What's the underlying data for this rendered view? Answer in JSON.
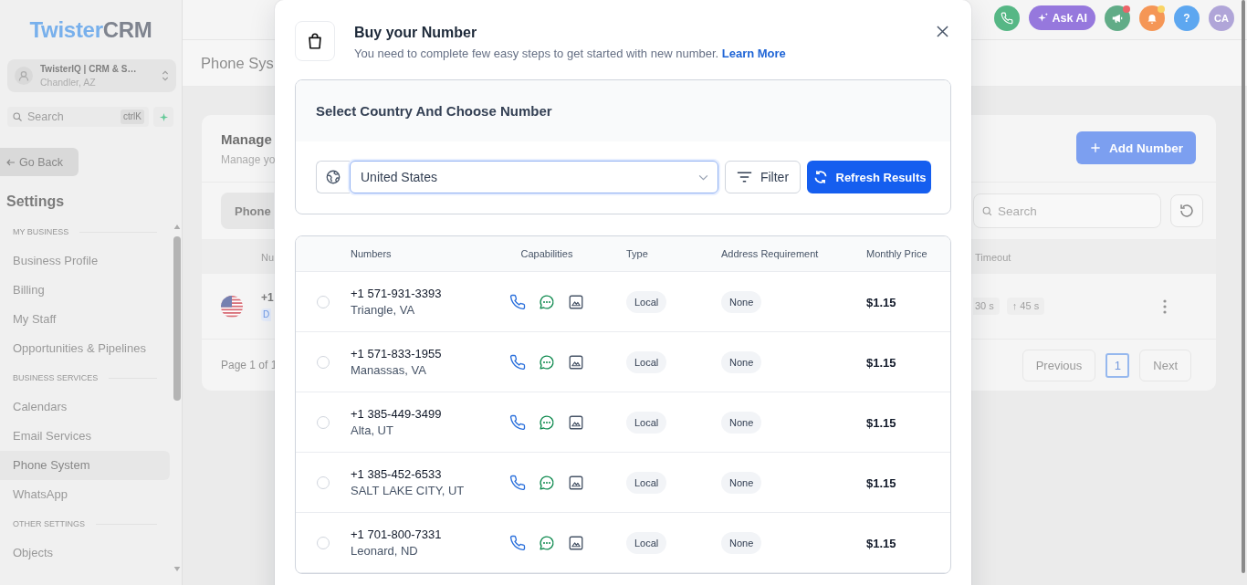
{
  "sidebar": {
    "brand": {
      "accent": "Twister",
      "rest": "CRM"
    },
    "account": {
      "name": "TwisterIQ | CRM & S…",
      "location": "Chandler, AZ"
    },
    "search": {
      "placeholder": "Search",
      "shortcut": "ctrlK"
    },
    "back_button": "Go Back",
    "heading": "Settings",
    "sections": [
      {
        "title": "MY BUSINESS",
        "items": [
          {
            "label": "Business Profile",
            "selected": false
          },
          {
            "label": "Billing",
            "selected": false
          },
          {
            "label": "My Staff",
            "selected": false
          },
          {
            "label": "Opportunities & Pipelines",
            "selected": false
          }
        ]
      },
      {
        "title": "BUSINESS SERVICES",
        "items": [
          {
            "label": "Calendars",
            "selected": false
          },
          {
            "label": "Email Services",
            "selected": false
          },
          {
            "label": "Phone System",
            "selected": true
          },
          {
            "label": "WhatsApp",
            "selected": false
          }
        ]
      },
      {
        "title": "OTHER SETTINGS",
        "items": [
          {
            "label": "Objects",
            "selected": false
          }
        ]
      }
    ]
  },
  "topbar": {
    "ask_ai": "Ask AI",
    "announcements_unread": true,
    "notifications_unread": true,
    "help": "?",
    "avatar": "CA"
  },
  "page": {
    "title": "Phone Sys",
    "card": {
      "title": "Manage",
      "subtitle": "Manage yo",
      "add_button": "Add Number",
      "tabs": [
        {
          "label": "Phone",
          "selected": true
        }
      ],
      "search": {
        "placeholder": "Search"
      },
      "columns": [
        "Nu",
        "Timeout"
      ],
      "rows": [
        {
          "number": "+1",
          "badge": "D",
          "timeouts": [
            "30 s",
            "↑ 45 s"
          ]
        }
      ],
      "pagination": {
        "summary": "Page 1 of 1",
        "previous": {
          "label": "Previous",
          "disabled": true
        },
        "pages": [
          {
            "label": "1",
            "selected": true
          }
        ],
        "next": {
          "label": "Next",
          "disabled": true
        }
      }
    }
  },
  "modal": {
    "title": "Buy your Number",
    "subtitle": "You need to complete few easy steps to get started with new number.",
    "link": "Learn More",
    "section": {
      "title": "Select Country And Choose Number",
      "country": "United States",
      "focused": true,
      "filter_button": "Filter",
      "refresh_button": "Refresh Results"
    },
    "table": {
      "columns": [
        "Numbers",
        "Capabilities",
        "Type",
        "Address Requirement",
        "Monthly Price"
      ],
      "rows": [
        {
          "number": "+1 571-931-3393",
          "location": "Triangle, VA",
          "selected": false,
          "capabilities": {
            "voice": true,
            "sms": true,
            "mms": true
          },
          "type": "Local",
          "address": "None",
          "price": "$1.15"
        },
        {
          "number": "+1 571-833-1955",
          "location": "Manassas, VA",
          "selected": false,
          "capabilities": {
            "voice": true,
            "sms": true,
            "mms": true
          },
          "type": "Local",
          "address": "None",
          "price": "$1.15"
        },
        {
          "number": "+1 385-449-3499",
          "location": "Alta, UT",
          "selected": false,
          "capabilities": {
            "voice": true,
            "sms": true,
            "mms": true
          },
          "type": "Local",
          "address": "None",
          "price": "$1.15"
        },
        {
          "number": "+1 385-452-6533",
          "location": "SALT LAKE CITY, UT",
          "selected": false,
          "capabilities": {
            "voice": true,
            "sms": true,
            "mms": true
          },
          "type": "Local",
          "address": "None",
          "price": "$1.15"
        },
        {
          "number": "+1 701-800-7331",
          "location": "Leonard, ND",
          "selected": false,
          "capabilities": {
            "voice": true,
            "sms": true,
            "mms": true
          },
          "type": "Local",
          "address": "None",
          "price": "$1.15"
        }
      ]
    }
  }
}
